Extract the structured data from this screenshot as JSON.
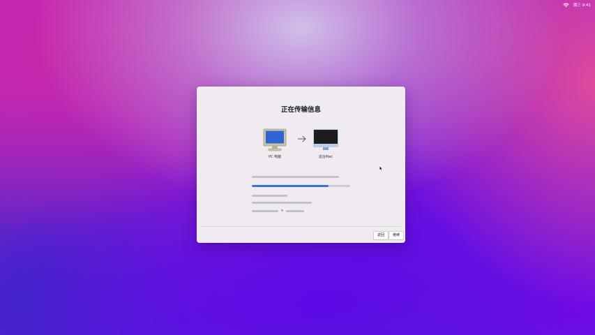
{
  "menubar": {
    "wifi_icon": "wifi-icon",
    "datetime": "周三 9:41"
  },
  "dialog": {
    "title": "正在传输信息",
    "source_device": {
      "label": "PC 电脑",
      "icon": "pc-monitor-icon",
      "screen_color": "#2f63d6"
    },
    "arrow_icon": "arrow-right-icon",
    "target_device": {
      "label": "这台Mac",
      "icon": "imac-icon",
      "screen_color": "#1c1c1e"
    },
    "progress": {
      "fraction": 0.78,
      "fill_color": "#3a6fd8"
    },
    "buttons": {
      "back_label": "返回",
      "continue_label": "继续"
    }
  }
}
